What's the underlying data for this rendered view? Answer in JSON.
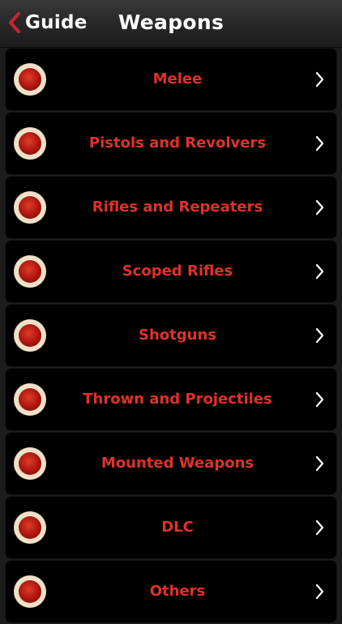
{
  "navbar": {
    "back_label": "Guide",
    "title": "Weapons"
  },
  "colors": {
    "accent_red": "#e03127",
    "back_chevron": "#c8262c",
    "row_background": "#000000",
    "icon_ring": "#efe1c8"
  },
  "icons": {
    "row_icon": "red-circle-icon",
    "row_chevron": "chevron-right-icon",
    "back": "chevron-left-icon"
  },
  "items": [
    {
      "label": "Melee"
    },
    {
      "label": "Pistols and Revolvers"
    },
    {
      "label": "Rifles and Repeaters"
    },
    {
      "label": "Scoped Rifles"
    },
    {
      "label": "Shotguns"
    },
    {
      "label": "Thrown and Projectiles"
    },
    {
      "label": "Mounted Weapons"
    },
    {
      "label": "DLC"
    },
    {
      "label": "Others"
    }
  ]
}
